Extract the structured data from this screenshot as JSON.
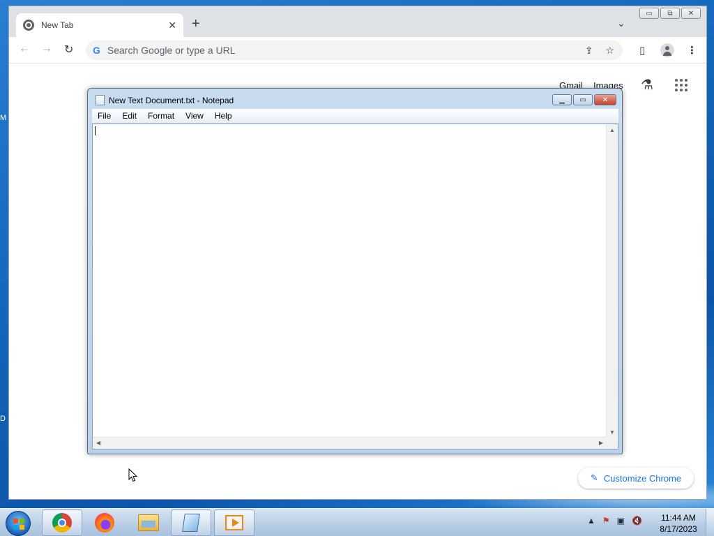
{
  "desktop": {
    "edge_labels": [
      "M",
      "D"
    ]
  },
  "chrome": {
    "tab_title": "New Tab",
    "tab_close": "✕",
    "new_tab": "+",
    "tab_search": "⌄",
    "window_controls": {
      "minimize": "▭",
      "restore": "⧉",
      "close": "✕"
    },
    "omnibox_placeholder": "Search Google or type a URL",
    "g_letter": "G",
    "nav": {
      "back": "←",
      "forward": "→",
      "reload": "↻"
    },
    "toolbar_icons": {
      "share": "⇪",
      "bookmark": "☆",
      "side_panel": "▯"
    },
    "links": {
      "gmail": "Gmail",
      "images": "Images"
    },
    "labs_icon": "⚗",
    "customize_label": "Customize Chrome",
    "customize_icon": "✎"
  },
  "notepad": {
    "title": "New Text Document.txt - Notepad",
    "menu": [
      "File",
      "Edit",
      "Format",
      "View",
      "Help"
    ],
    "controls": {
      "minimize": "▁",
      "maximize": "▭",
      "close": "✕"
    },
    "content": ""
  },
  "taskbar": {
    "clock_time": "11:44 AM",
    "clock_date": "8/17/2023",
    "tray_icons": {
      "show_hidden": "▲",
      "action_center": "⚑",
      "network": "▣",
      "volume": "🔇"
    }
  }
}
